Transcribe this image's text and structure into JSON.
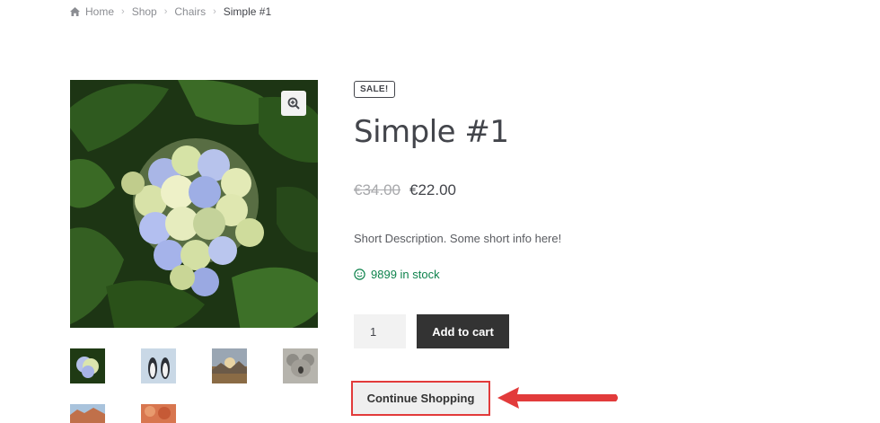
{
  "breadcrumb": {
    "icon": "home-icon",
    "items": [
      "Home",
      "Shop",
      "Chairs"
    ],
    "current": "Simple #1",
    "separator": "›"
  },
  "gallery": {
    "zoom_icon": "zoom-in-icon",
    "thumbnails": [
      "hydrangea",
      "penguins",
      "landscape",
      "koala",
      "desert",
      "flowers"
    ]
  },
  "product": {
    "badge": "SALE!",
    "title": "Simple #1",
    "old_price": "€34.00",
    "price": "€22.00",
    "short_description": "Short Description. Some short info here!",
    "stock": "9899 in stock",
    "quantity": "1",
    "add_to_cart_label": "Add to cart",
    "continue_shopping_label": "Continue Shopping"
  },
  "colors": {
    "stock_green": "#0f834d",
    "button_dark": "#333333",
    "annotation_red": "#e23b3b"
  }
}
